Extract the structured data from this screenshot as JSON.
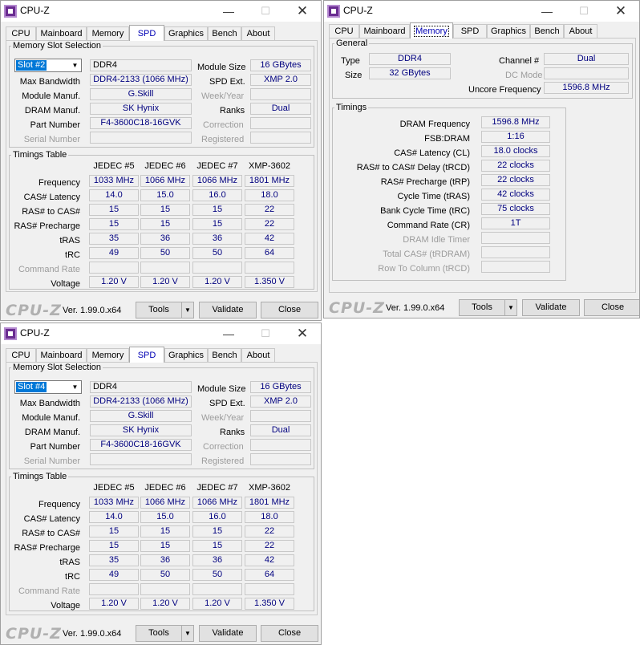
{
  "windows": {
    "win1": {
      "title": "CPU-Z",
      "tabs": [
        "CPU",
        "Mainboard",
        "Memory",
        "SPD",
        "Graphics",
        "Bench",
        "About"
      ],
      "slot_group": "Memory Slot Selection",
      "slot": "Slot #2",
      "memtype": "DDR4",
      "labels": {
        "module_size": "Module Size",
        "spd_ext": "SPD Ext.",
        "week_year": "Week/Year",
        "ranks": "Ranks",
        "correction": "Correction",
        "registered": "Registered",
        "max_bw": "Max Bandwidth",
        "module_manuf": "Module Manuf.",
        "dram_manuf": "DRAM Manuf.",
        "part_number": "Part Number",
        "serial_number": "Serial Number"
      },
      "module_size": "16 GBytes",
      "spd_ext": "XMP 2.0",
      "ranks": "Dual",
      "max_bw": "DDR4-2133 (1066 MHz)",
      "module_manuf": "G.Skill",
      "dram_manuf": "SK Hynix",
      "part_number": "F4-3600C18-16GVK",
      "timings_group": "Timings Table",
      "cols": [
        "JEDEC #5",
        "JEDEC #6",
        "JEDEC #7",
        "XMP-3602"
      ],
      "rows": [
        {
          "label": "Frequency",
          "values": [
            "1033 MHz",
            "1066 MHz",
            "1066 MHz",
            "1801 MHz"
          ]
        },
        {
          "label": "CAS# Latency",
          "values": [
            "14.0",
            "15.0",
            "16.0",
            "18.0"
          ]
        },
        {
          "label": "RAS# to CAS#",
          "values": [
            "15",
            "15",
            "15",
            "22"
          ]
        },
        {
          "label": "RAS# Precharge",
          "values": [
            "15",
            "15",
            "15",
            "22"
          ]
        },
        {
          "label": "tRAS",
          "values": [
            "35",
            "36",
            "36",
            "42"
          ]
        },
        {
          "label": "tRC",
          "values": [
            "49",
            "50",
            "50",
            "64"
          ]
        },
        {
          "label": "Command Rate",
          "values": [
            "",
            "",
            "",
            ""
          ]
        },
        {
          "label": "Voltage",
          "values": [
            "1.20 V",
            "1.20 V",
            "1.20 V",
            "1.350 V"
          ]
        }
      ],
      "logo": "CPU-Z",
      "version": "Ver. 1.99.0.x64",
      "tools": "Tools",
      "validate": "Validate",
      "close": "Close"
    },
    "win2": {
      "title": "CPU-Z",
      "tabs": [
        "CPU",
        "Mainboard",
        "Memory",
        "SPD",
        "Graphics",
        "Bench",
        "About"
      ],
      "general_group": "General",
      "labels": {
        "type": "Type",
        "size": "Size",
        "channel": "Channel #",
        "dc_mode": "DC Mode",
        "uncore": "Uncore Frequency"
      },
      "type": "DDR4",
      "size": "32 GBytes",
      "channel": "Dual",
      "dc_mode": "",
      "uncore": "1596.8 MHz",
      "timings_group": "Timings",
      "timings": [
        {
          "label": "DRAM Frequency",
          "value": "1596.8 MHz",
          "dim": false
        },
        {
          "label": "FSB:DRAM",
          "value": "1:16",
          "dim": false
        },
        {
          "label": "CAS# Latency (CL)",
          "value": "18.0 clocks",
          "dim": false
        },
        {
          "label": "RAS# to CAS# Delay (tRCD)",
          "value": "22 clocks",
          "dim": false
        },
        {
          "label": "RAS# Precharge (tRP)",
          "value": "22 clocks",
          "dim": false
        },
        {
          "label": "Cycle Time (tRAS)",
          "value": "42 clocks",
          "dim": false
        },
        {
          "label": "Bank Cycle Time (tRC)",
          "value": "75 clocks",
          "dim": false
        },
        {
          "label": "Command Rate (CR)",
          "value": "1T",
          "dim": false
        },
        {
          "label": "DRAM Idle Timer",
          "value": "",
          "dim": true
        },
        {
          "label": "Total CAS# (tRDRAM)",
          "value": "",
          "dim": true
        },
        {
          "label": "Row To Column (tRCD)",
          "value": "",
          "dim": true
        }
      ],
      "logo": "CPU-Z",
      "version": "Ver. 1.99.0.x64",
      "tools": "Tools",
      "validate": "Validate",
      "close": "Close"
    },
    "win3": {
      "title": "CPU-Z",
      "tabs": [
        "CPU",
        "Mainboard",
        "Memory",
        "SPD",
        "Graphics",
        "Bench",
        "About"
      ],
      "slot_group": "Memory Slot Selection",
      "slot": "Slot #4",
      "memtype": "DDR4",
      "labels": {
        "module_size": "Module Size",
        "spd_ext": "SPD Ext.",
        "week_year": "Week/Year",
        "ranks": "Ranks",
        "correction": "Correction",
        "registered": "Registered",
        "max_bw": "Max Bandwidth",
        "module_manuf": "Module Manuf.",
        "dram_manuf": "DRAM Manuf.",
        "part_number": "Part Number",
        "serial_number": "Serial Number"
      },
      "module_size": "16 GBytes",
      "spd_ext": "XMP 2.0",
      "ranks": "Dual",
      "max_bw": "DDR4-2133 (1066 MHz)",
      "module_manuf": "G.Skill",
      "dram_manuf": "SK Hynix",
      "part_number": "F4-3600C18-16GVK",
      "timings_group": "Timings Table",
      "cols": [
        "JEDEC #5",
        "JEDEC #6",
        "JEDEC #7",
        "XMP-3602"
      ],
      "rows": [
        {
          "label": "Frequency",
          "values": [
            "1033 MHz",
            "1066 MHz",
            "1066 MHz",
            "1801 MHz"
          ]
        },
        {
          "label": "CAS# Latency",
          "values": [
            "14.0",
            "15.0",
            "16.0",
            "18.0"
          ]
        },
        {
          "label": "RAS# to CAS#",
          "values": [
            "15",
            "15",
            "15",
            "22"
          ]
        },
        {
          "label": "RAS# Precharge",
          "values": [
            "15",
            "15",
            "15",
            "22"
          ]
        },
        {
          "label": "tRAS",
          "values": [
            "35",
            "36",
            "36",
            "42"
          ]
        },
        {
          "label": "tRC",
          "values": [
            "49",
            "50",
            "50",
            "64"
          ]
        },
        {
          "label": "Command Rate",
          "values": [
            "",
            "",
            "",
            ""
          ]
        },
        {
          "label": "Voltage",
          "values": [
            "1.20 V",
            "1.20 V",
            "1.20 V",
            "1.350 V"
          ]
        }
      ],
      "logo": "CPU-Z",
      "version": "Ver. 1.99.0.x64",
      "tools": "Tools",
      "validate": "Validate",
      "close": "Close"
    }
  }
}
